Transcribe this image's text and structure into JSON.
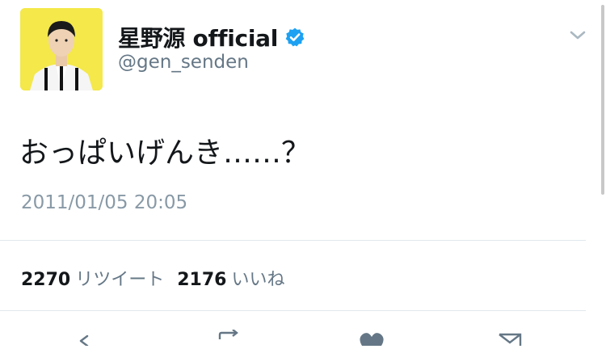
{
  "tweet": {
    "display_name": "星野源 official",
    "handle": "@gen_senden",
    "text": "おっぱいげんき……？",
    "timestamp": "2011/01/05 20:05",
    "retweets": {
      "count": "2270",
      "label": "リツイート"
    },
    "likes": {
      "count": "2176",
      "label": "いいね"
    },
    "verified": true
  },
  "colors": {
    "avatar_bg": "#f4e84a",
    "verified": "#1da1f2",
    "muted_text": "#657786",
    "timestamp": "#8899a6",
    "divider": "#e1e8ed"
  },
  "icons": [
    "verified-badge-icon",
    "chevron-down-icon",
    "reply-icon",
    "retweet-icon",
    "like-icon",
    "dm-icon"
  ]
}
